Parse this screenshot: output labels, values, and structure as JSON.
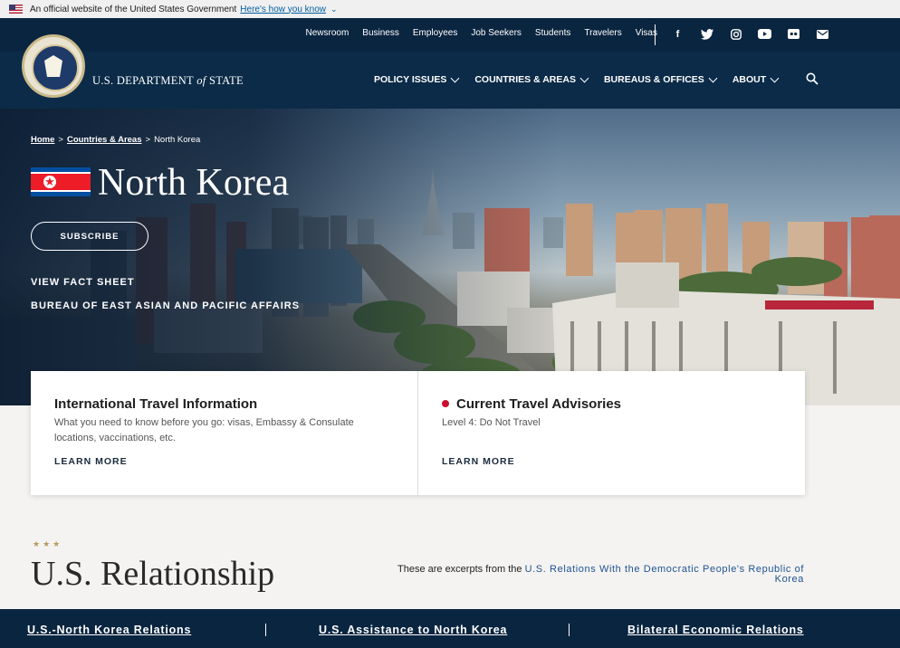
{
  "gov_banner": {
    "official_text": "An official website of the United States Government",
    "how_link": "Here's how you know"
  },
  "header": {
    "top_nav": [
      "Newsroom",
      "Business",
      "Employees",
      "Job Seekers",
      "Students",
      "Travelers",
      "Visas"
    ],
    "social_icons": [
      "facebook-icon",
      "twitter-icon",
      "instagram-icon",
      "youtube-icon",
      "flickr-icon",
      "email-icon"
    ],
    "brand_prefix": "U.S. DEPARTMENT",
    "brand_of": "of",
    "brand_suffix": "STATE",
    "main_nav": [
      "POLICY ISSUES",
      "COUNTRIES & AREAS",
      "BUREAUS & OFFICES",
      "ABOUT"
    ]
  },
  "hero": {
    "breadcrumb": [
      "Home",
      "Countries & Areas",
      "North Korea"
    ],
    "breadcrumb_sep": ">",
    "title": "North Korea",
    "subscribe_label": "SUBSCRIBE",
    "fact_sheet_label": "VIEW FACT SHEET",
    "bureau_label": "BUREAU OF EAST ASIAN AND PACIFIC AFFAIRS"
  },
  "cards": [
    {
      "title": "International Travel Information",
      "text": "What you need to know before you go: visas, Embassy & Consulate locations, vaccinations, etc.",
      "link": "LEARN MORE"
    },
    {
      "title": "Current Travel Advisories",
      "text": "Level 4: Do Not Travel",
      "link": "LEARN MORE",
      "status_color": "#c8102e"
    }
  ],
  "relationship": {
    "stars": "★★★",
    "title": "U.S. Relationship",
    "excerpt_prefix": "These are excerpts from the",
    "excerpt_link": "U.S. Relations With the Democratic People's Republic of Korea"
  },
  "bottom_links": [
    "U.S.-North Korea Relations",
    "U.S. Assistance to North Korea",
    "Bilateral Economic Relations"
  ],
  "colors": {
    "navy": "#0a2540",
    "header_blue": "#0b2b48",
    "link_blue": "#205493",
    "gold": "#b79a5b",
    "alert_red": "#c8102e"
  }
}
